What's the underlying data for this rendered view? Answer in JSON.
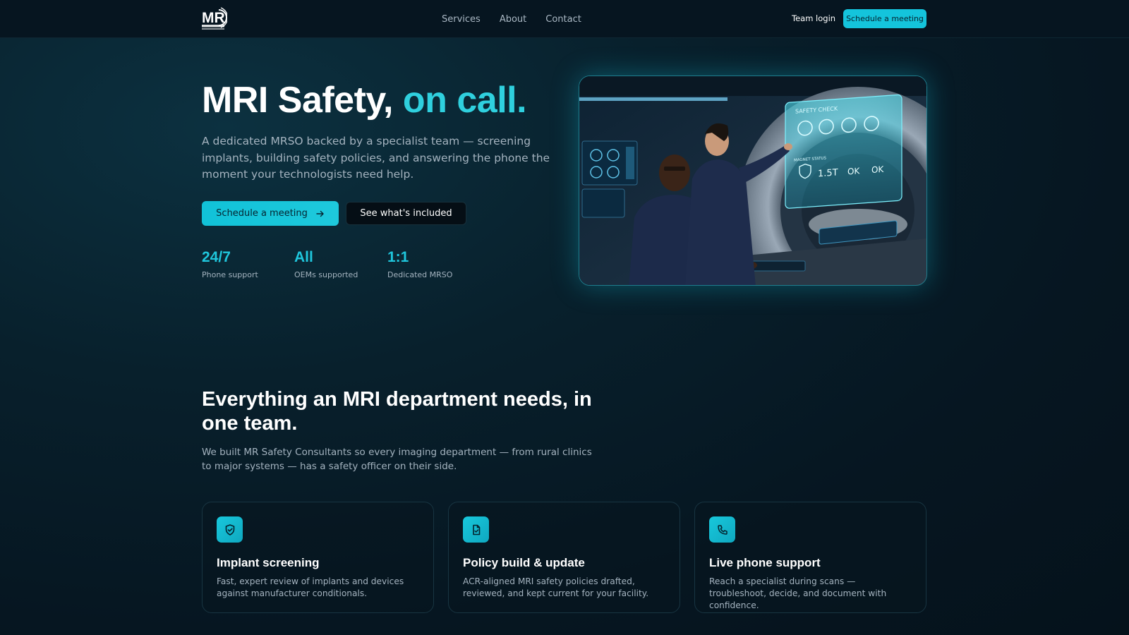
{
  "nav": {
    "links": [
      "Services",
      "About",
      "Contact"
    ],
    "team_login": "Team login",
    "cta": "Schedule a meeting"
  },
  "hero": {
    "title_main": "MRI Safety,",
    "title_accent": "on call.",
    "description": "A dedicated MRSO backed by a specialist team — screening implants, building safety policies, and answering the phone the moment your technologists need help.",
    "primary_cta": "Schedule a meeting",
    "secondary_cta": "See what's included",
    "stats": [
      {
        "value": "24/7",
        "label": "Phone support"
      },
      {
        "value": "All",
        "label": "OEMs supported"
      },
      {
        "value": "1:1",
        "label": "Dedicated MRSO"
      }
    ],
    "image": {
      "panel_title": "SAFETY CHECK",
      "magnet_status": "MAGNET STATUS",
      "field_strength": "1.5T",
      "status_1": "OK",
      "status_2": "OK"
    }
  },
  "features": {
    "title": "Everything an MRI department needs, in one team.",
    "description": "We built MR Safety Consultants so every imaging department — from rural clinics to major systems — has a safety officer on their side.",
    "cards": [
      {
        "icon": "shield-icon",
        "title": "Implant screening",
        "description": "Fast, expert review of implants and devices against manufacturer conditionals."
      },
      {
        "icon": "document-icon",
        "title": "Policy build & update",
        "description": "ACR-aligned MRI safety policies drafted, reviewed, and kept current for your facility."
      },
      {
        "icon": "phone-icon",
        "title": "Live phone support",
        "description": "Reach a specialist during scans — troubleshoot, decide, and document with confidence."
      }
    ]
  },
  "colors": {
    "accent": "#1fc6dc",
    "background": "#071a25"
  }
}
